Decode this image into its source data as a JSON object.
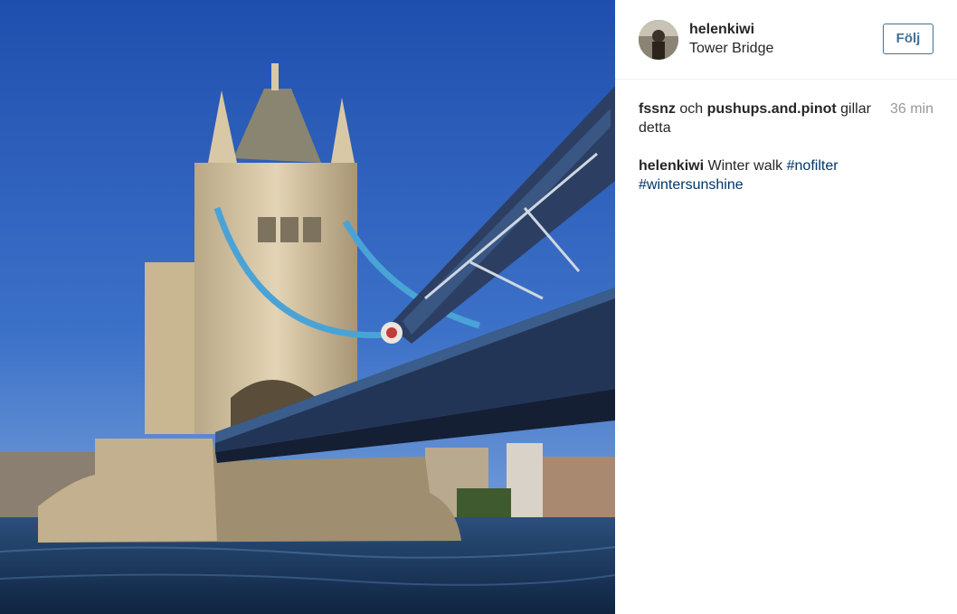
{
  "photo": {
    "alt": "Tower Bridge"
  },
  "header": {
    "username": "helenkiwi",
    "location": "Tower Bridge",
    "follow_label": "Följ"
  },
  "likes": {
    "user1": "fssnz",
    "connector": "och",
    "user2": "pushups.and.pinot",
    "suffix": "gillar detta",
    "time": "36 min"
  },
  "caption": {
    "username": "helenkiwi",
    "text": "Winter walk",
    "tags": [
      "#nofilter",
      "#wintersunshine"
    ]
  },
  "colors": {
    "link": "#003569",
    "follow": "#3f729b",
    "muted": "#999999"
  }
}
